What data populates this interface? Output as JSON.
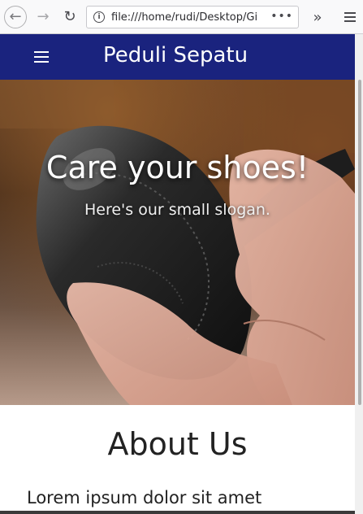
{
  "browser": {
    "url": "file:///home/rudi/Desktop/Gi",
    "page_actions_glyph": "•••",
    "overflow_glyph": "»"
  },
  "header": {
    "title": "Peduli Sepatu"
  },
  "hero": {
    "title": "Care your shoes!",
    "slogan": "Here's our small slogan."
  },
  "about": {
    "heading": "About Us",
    "subheading": "Lorem ipsum dolor sit amet"
  },
  "colors": {
    "appbar": "#1a237e",
    "toolbar": "#f9f9fa"
  }
}
